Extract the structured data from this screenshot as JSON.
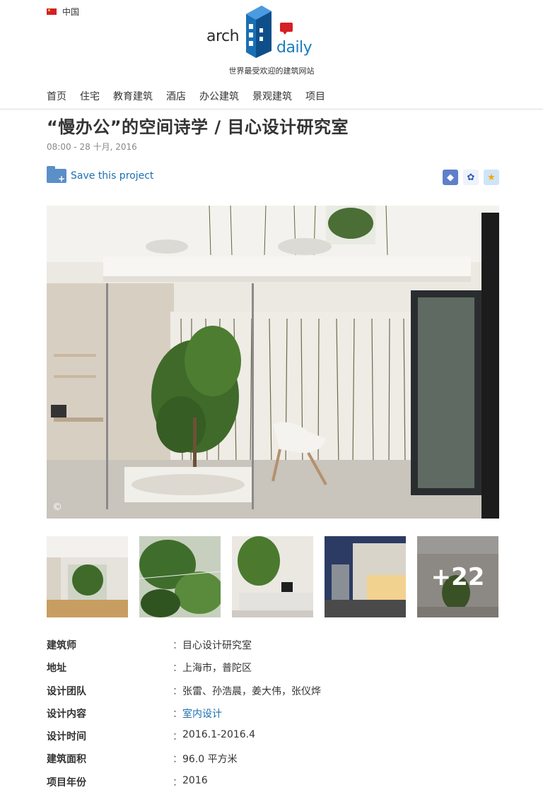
{
  "country": {
    "label": "中国",
    "flag_color": "#d61f26"
  },
  "logo": {
    "left_text": "arch",
    "right_text": "daily",
    "tagline": "世界最受欢迎的建筑网站",
    "brand_color": "#1a7dc0"
  },
  "nav": {
    "items": [
      "首页",
      "住宅",
      "教育建筑",
      "酒店",
      "办公建筑",
      "景观建筑",
      "项目"
    ]
  },
  "article": {
    "title": "“慢办公”的空间诗学 / 目心设计研究室",
    "date": "08:00 - 28 十月, 2016",
    "save_label": "Save this project",
    "copyright_symbol": "©"
  },
  "share": {
    "icons": [
      "weibo-icon",
      "baidu-icon",
      "favorite-icon"
    ]
  },
  "gallery": {
    "more_count": "+22",
    "thumb_count": 5
  },
  "specs": [
    {
      "key": "建筑师",
      "value": "目心设计研究室"
    },
    {
      "key": "地址",
      "value": "上海市，普陀区"
    },
    {
      "key": "设计团队",
      "value": "张雷、孙浩晨，姜大伟，张仪烨"
    },
    {
      "key": "设计内容",
      "value": "室内设计",
      "link": true
    },
    {
      "key": "设计时间",
      "value": "2016.1-2016.4"
    },
    {
      "key": "建筑面积",
      "value": "96.0 平方米"
    },
    {
      "key": "项目年份",
      "value": "2016"
    }
  ],
  "colon": "："
}
